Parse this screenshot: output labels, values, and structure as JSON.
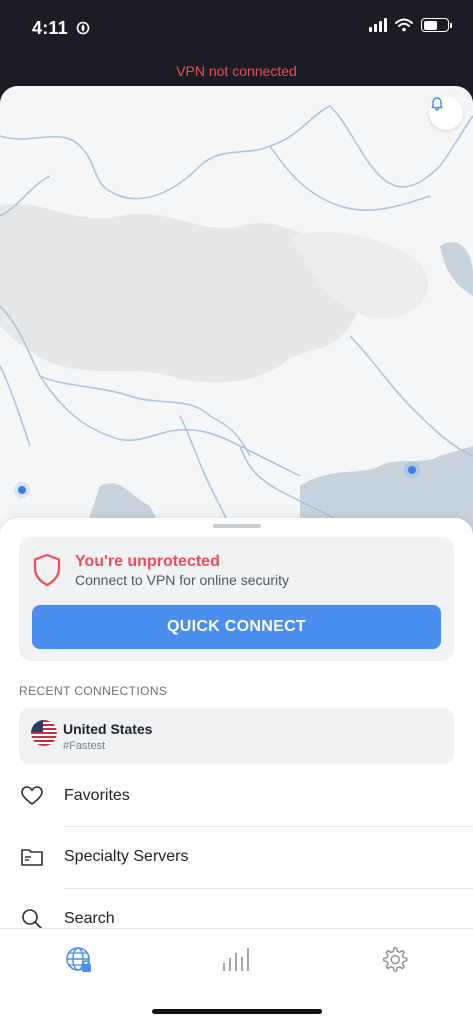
{
  "status_bar": {
    "time": "4:11"
  },
  "vpn_status": "VPN not connected",
  "colors": {
    "accent": "#4a8ef0",
    "warning": "#ef4b5a",
    "dark_bg": "#1c1d24"
  },
  "map": {
    "bell_icon": "bell-icon"
  },
  "protection": {
    "title": "You're unprotected",
    "subtitle": "Connect to VPN for online security",
    "button_label": "QUICK CONNECT"
  },
  "recent": {
    "section_label": "RECENT CONNECTIONS",
    "items": [
      {
        "country": "United States",
        "sub": "#Fastest"
      }
    ]
  },
  "menu": [
    {
      "label": "Favorites",
      "icon": "heart-icon"
    },
    {
      "label": "Specialty Servers",
      "icon": "folder-icon"
    },
    {
      "label": "Search",
      "icon": "search-icon"
    }
  ],
  "tabs": [
    {
      "icon": "globe-lock-icon",
      "active": true
    },
    {
      "icon": "stats-bars-icon",
      "active": false
    },
    {
      "icon": "gear-icon",
      "active": false
    }
  ]
}
